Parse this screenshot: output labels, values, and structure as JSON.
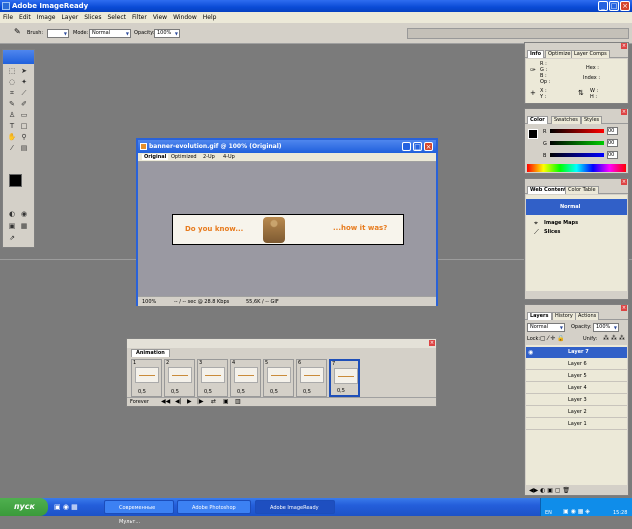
{
  "app": {
    "title": "Adobe ImageReady"
  },
  "menu": [
    "File",
    "Edit",
    "Image",
    "Layer",
    "Slices",
    "Select",
    "Filter",
    "View",
    "Window",
    "Help"
  ],
  "options": {
    "brush_label": "Brush:",
    "mode_label": "Mode:",
    "mode_value": "Normal",
    "opacity_label": "Opacity:",
    "opacity_value": "100%"
  },
  "document": {
    "title": "banner-evolution.gif @ 100% (Original)",
    "tabs": [
      "Original",
      "Optimized",
      "2-Up",
      "4-Up"
    ],
    "banner_left": "Do you know...",
    "banner_right": "...how it was?",
    "zoom": "100%",
    "speed": "-- / -- sec @ 28.8 Kbps",
    "size": "55,6K / -- GIF"
  },
  "info_panel": {
    "tabs": [
      "Info",
      "Optimize",
      "Layer Comps"
    ],
    "r": "R :",
    "g": "G :",
    "b": "B :",
    "op": "Op :",
    "hex": "Hex :",
    "index": "Index :",
    "x": "X :",
    "y": "Y :",
    "w": "W :",
    "h": "H :"
  },
  "color_panel": {
    "tabs": [
      "Color",
      "Swatches",
      "Styles"
    ],
    "r_val": "00",
    "g_val": "00",
    "b_val": "00",
    "r": "R",
    "g": "G",
    "b": "B"
  },
  "web_panel": {
    "tabs": [
      "Web Content",
      "Color Table"
    ],
    "normal": "Normal",
    "image_maps": "Image Maps",
    "slices": "Slices"
  },
  "layers_panel": {
    "tabs": [
      "Layers",
      "History",
      "Actions"
    ],
    "blend": "Normal",
    "opacity_label": "Opacity:",
    "opacity": "100%",
    "lock_label": "Lock:",
    "unify_label": "Unify:",
    "layers": [
      "Layer 7",
      "Layer 6",
      "Layer 5",
      "Layer 4",
      "Layer 3",
      "Layer 2",
      "Layer 1"
    ]
  },
  "animation": {
    "tab": "Animation",
    "frames": [
      {
        "n": "1",
        "d": "0,5"
      },
      {
        "n": "2",
        "d": "0,5"
      },
      {
        "n": "3",
        "d": "0,5"
      },
      {
        "n": "4",
        "d": "0,5"
      },
      {
        "n": "5",
        "d": "0,5"
      },
      {
        "n": "6",
        "d": "0,5"
      },
      {
        "n": "7",
        "d": "0,5"
      }
    ],
    "loop": "Forever"
  },
  "taskbar": {
    "start": "пуск",
    "items": [
      "Современные Мульт...",
      "Adobe Photoshop",
      "Adobe ImageReady"
    ],
    "lang": "EN",
    "time": "15:28"
  }
}
